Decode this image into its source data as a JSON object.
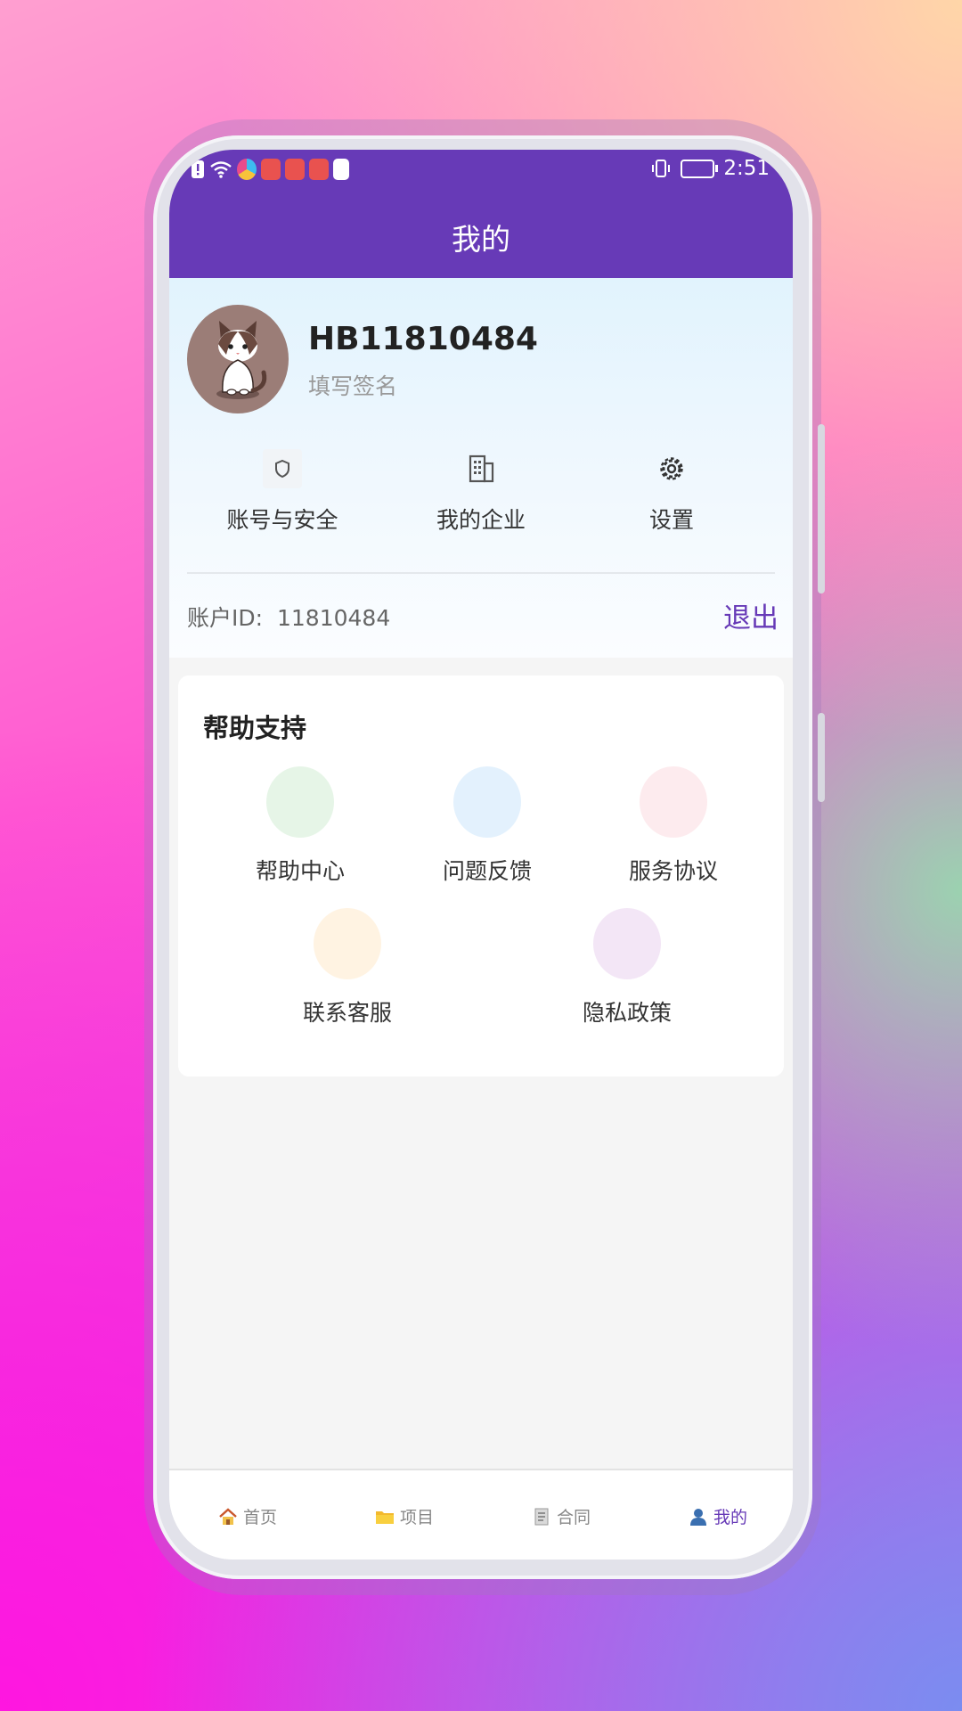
{
  "status_bar": {
    "time": "2:51"
  },
  "header": {
    "title": "我的"
  },
  "profile": {
    "username": "HB11810484",
    "signature_placeholder": "填写签名",
    "quick_actions": [
      {
        "label": "账号与安全",
        "icon": "shield-icon"
      },
      {
        "label": "我的企业",
        "icon": "building-icon"
      },
      {
        "label": "设置",
        "icon": "gear-icon"
      }
    ],
    "account_id_label": "账户ID:",
    "account_id": "11810484",
    "logout_label": "退出"
  },
  "help": {
    "title": "帮助支持",
    "items": [
      {
        "label": "帮助中心",
        "color": "#e6f5e7"
      },
      {
        "label": "问题反馈",
        "color": "#e3f1fd"
      },
      {
        "label": "服务协议",
        "color": "#fdebee"
      },
      {
        "label": "联系客服",
        "color": "#fff3e2"
      },
      {
        "label": "隐私政策",
        "color": "#f3e6f6"
      }
    ]
  },
  "tabbar": {
    "items": [
      {
        "label": "首页",
        "icon": "house-icon"
      },
      {
        "label": "项目",
        "icon": "folder-icon"
      },
      {
        "label": "合同",
        "icon": "document-icon"
      },
      {
        "label": "我的",
        "icon": "person-icon"
      }
    ],
    "active_index": 3
  },
  "colors": {
    "primary": "#673ab7",
    "page_bg": "#f5f5f5"
  }
}
